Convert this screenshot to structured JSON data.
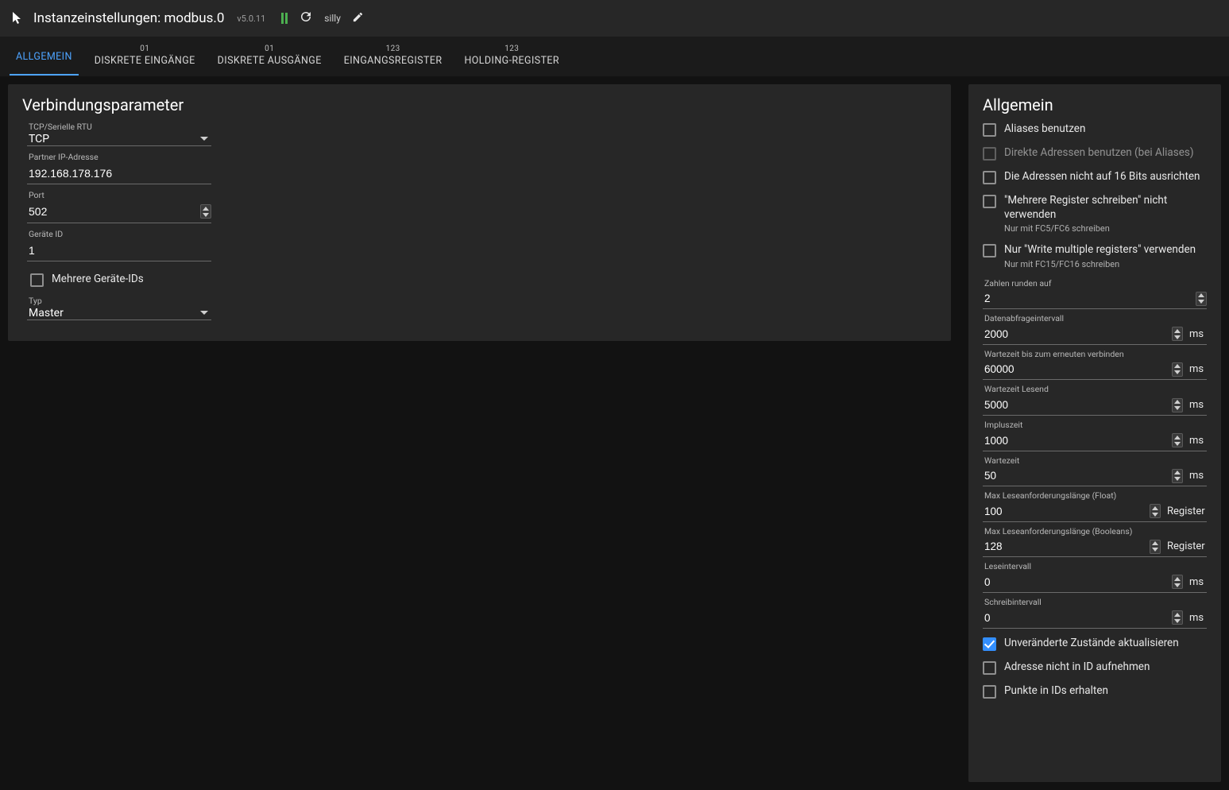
{
  "header": {
    "title": "Instanzeinstellungen: modbus.0",
    "version": "v5.0.11",
    "log_level": "silly"
  },
  "tabs": [
    {
      "count": "",
      "label": "ALLGEMEIN",
      "active": true
    },
    {
      "count": "01",
      "label": "DISKRETE EINGÄNGE"
    },
    {
      "count": "01",
      "label": "DISKRETE AUSGÄNGE"
    },
    {
      "count": "123",
      "label": "EINGANGSREGISTER"
    },
    {
      "count": "123",
      "label": "HOLDING-REGISTER"
    }
  ],
  "left": {
    "title": "Verbindungsparameter",
    "conn_type_label": "TCP/Serielle RTU",
    "conn_type_value": "TCP",
    "ip_label": "Partner IP-Adresse",
    "ip_value": "192.168.178.176",
    "port_label": "Port",
    "port_value": "502",
    "device_id_label": "Geräte ID",
    "device_id_value": "1",
    "multi_ids_label": "Mehrere Geräte-IDs",
    "type_label": "Typ",
    "type_value": "Master"
  },
  "right": {
    "title": "Allgemein",
    "cb_aliases": "Aliases benutzen",
    "cb_direct_addr": "Direkte Adressen benutzen (bei Aliases)",
    "cb_no_align": "Die Adressen nicht auf 16 Bits ausrichten",
    "cb_no_multi_write": "\"Mehrere Register schreiben\" nicht verwenden",
    "cb_no_multi_write_sub": "Nur mit FC5/FC6 schreiben",
    "cb_only_multi_write": "Nur \"Write multiple registers\" verwenden",
    "cb_only_multi_write_sub": "Nur mit FC15/FC16 schreiben",
    "round_label": "Zahlen runden auf",
    "round_value": "2",
    "poll_label": "Datenabfrageintervall",
    "poll_value": "2000",
    "reconnect_label": "Wartezeit bis zum erneuten verbinden",
    "reconnect_value": "60000",
    "read_wait_label": "Wartezeit Lesend",
    "read_wait_value": "5000",
    "pulse_label": "Impluszeit",
    "pulse_value": "1000",
    "wait_label": "Wartezeit",
    "wait_value": "50",
    "max_read_float_label": "Max Leseanforderungslänge (Float)",
    "max_read_float_value": "100",
    "max_read_bool_label": "Max Leseanforderungslänge (Booleans)",
    "max_read_bool_value": "128",
    "read_interval_label": "Leseintervall",
    "read_interval_value": "0",
    "write_interval_label": "Schreibintervall",
    "write_interval_value": "0",
    "unit_ms": "ms",
    "unit_register": "Register",
    "cb_update_unchanged": "Unveränderte Zustände aktualisieren",
    "cb_no_addr_in_id": "Adresse nicht in ID aufnehmen",
    "cb_keep_dots": "Punkte in IDs erhalten"
  }
}
